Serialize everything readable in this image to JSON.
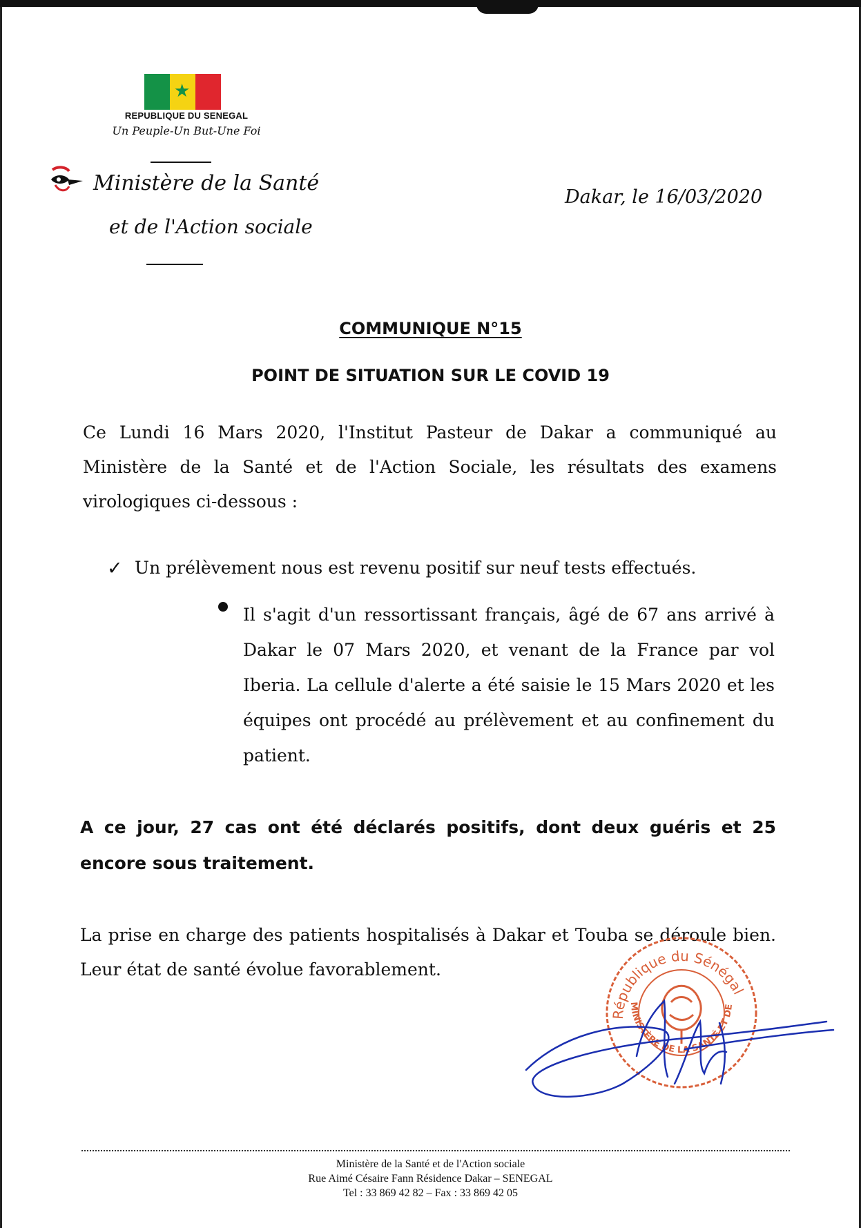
{
  "header": {
    "republic": "REPUBLIQUE DU SENEGAL",
    "motto": "Un Peuple-Un But-Une Foi",
    "ministry_line1": "Ministère de la Santé",
    "ministry_line2": "et de l'Action sociale",
    "date": "Dakar, le 16/03/2020",
    "flag_colors": [
      "#149247",
      "#f5d313",
      "#e0262e"
    ]
  },
  "title": "COMMUNIQUE N°15",
  "subject": "POINT DE SITUATION SUR LE COVID 19",
  "intro": "Ce Lundi 16 Mars 2020, l'Institut Pasteur de Dakar a communiqué au Ministère de la Santé et de l'Action Sociale, les résultats des examens virologiques ci-dessous :",
  "check_item": "Un prélèvement nous est revenu positif sur neuf tests effectués.",
  "bullet_item": "Il s'agit d'un ressortissant français, âgé de 67 ans arrivé à Dakar le 07 Mars 2020, et venant de la France par vol Iberia. La cellule d'alerte a été saisie le 15 Mars 2020 et les équipes ont procédé au prélèvement et au confinement du patient.",
  "summary": "A ce jour, 27 cas ont été déclarés positifs, dont deux guéris et 25 encore sous traitement.",
  "closing": "La prise en charge des patients hospitalisés à Dakar et Touba se déroule bien. Leur état de santé évolue favorablement.",
  "stamp": {
    "outer_text": "République du Sénégal",
    "inner_text": "MINISTÈRE DE LA SANTÉ ET DE L'ACTION SOCIALE",
    "color": "#d9603a"
  },
  "signature_color": "#1b2fb0",
  "footer": {
    "line1": "Ministère de la Santé et de l'Action sociale",
    "line2": "Rue Aimé Césaire Fann Résidence Dakar – SENEGAL",
    "line3": "Tel : 33 869 42 82 – Fax : 33 869 42 05"
  }
}
